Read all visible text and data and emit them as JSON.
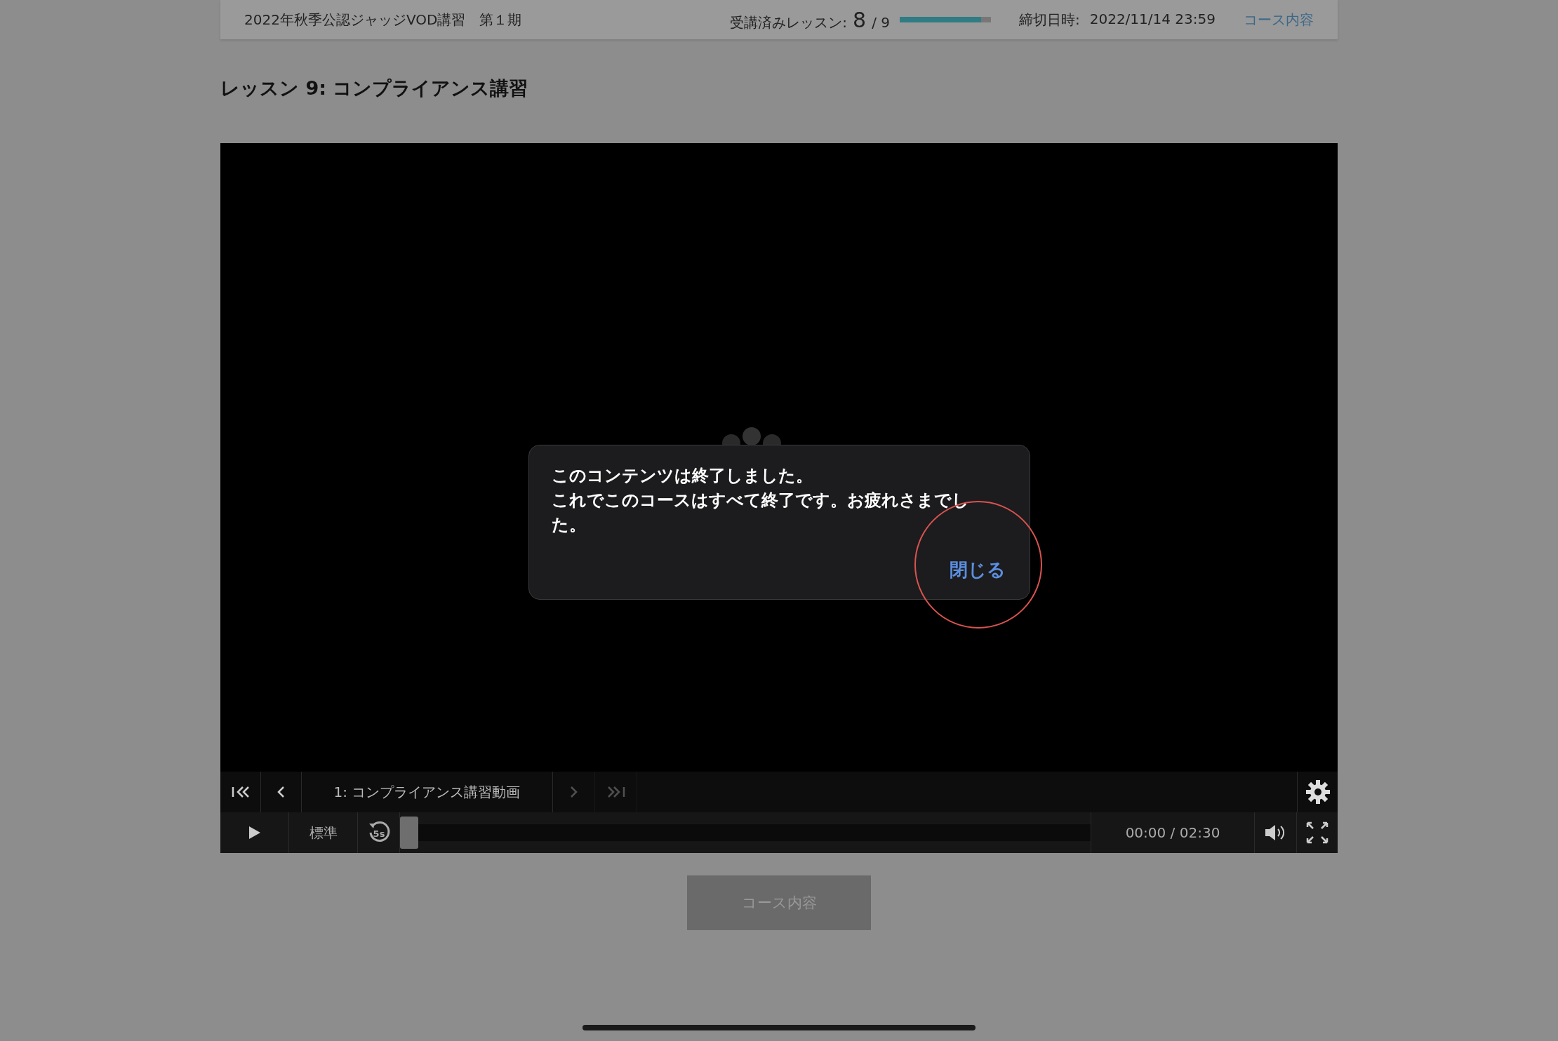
{
  "header": {
    "course_title": "2022年秋季公認ジャッジVOD講習　第１期",
    "progress_label": "受講済みレッスン:",
    "completed": "8",
    "total": "/ 9",
    "level": 0.89,
    "deadline_label": "締切日時:",
    "deadline": "2022/11/14 23:59",
    "course_link": "コース内容"
  },
  "lesson_title": "レッスン 9: コンプライアンス講習",
  "player": {
    "nav": [
      {
        "kind": "first",
        "disabled": false
      },
      {
        "kind": "prev",
        "disabled": false
      },
      {
        "kind": "title",
        "label": "1: コンプライアンス講習動画"
      },
      {
        "kind": "next",
        "disabled": true
      },
      {
        "kind": "last",
        "disabled": true
      }
    ],
    "speed": "標準",
    "replay_label": "5s",
    "level": 0,
    "time": "00:00 / 02:30"
  },
  "dialog": {
    "lines": [
      "このコンテンツは終了しました。",
      "これでこのコースはすべて終了です。お疲れさまでした。"
    ],
    "close": "閉じる",
    "highlighted": true
  },
  "course_button": "コース内容"
}
